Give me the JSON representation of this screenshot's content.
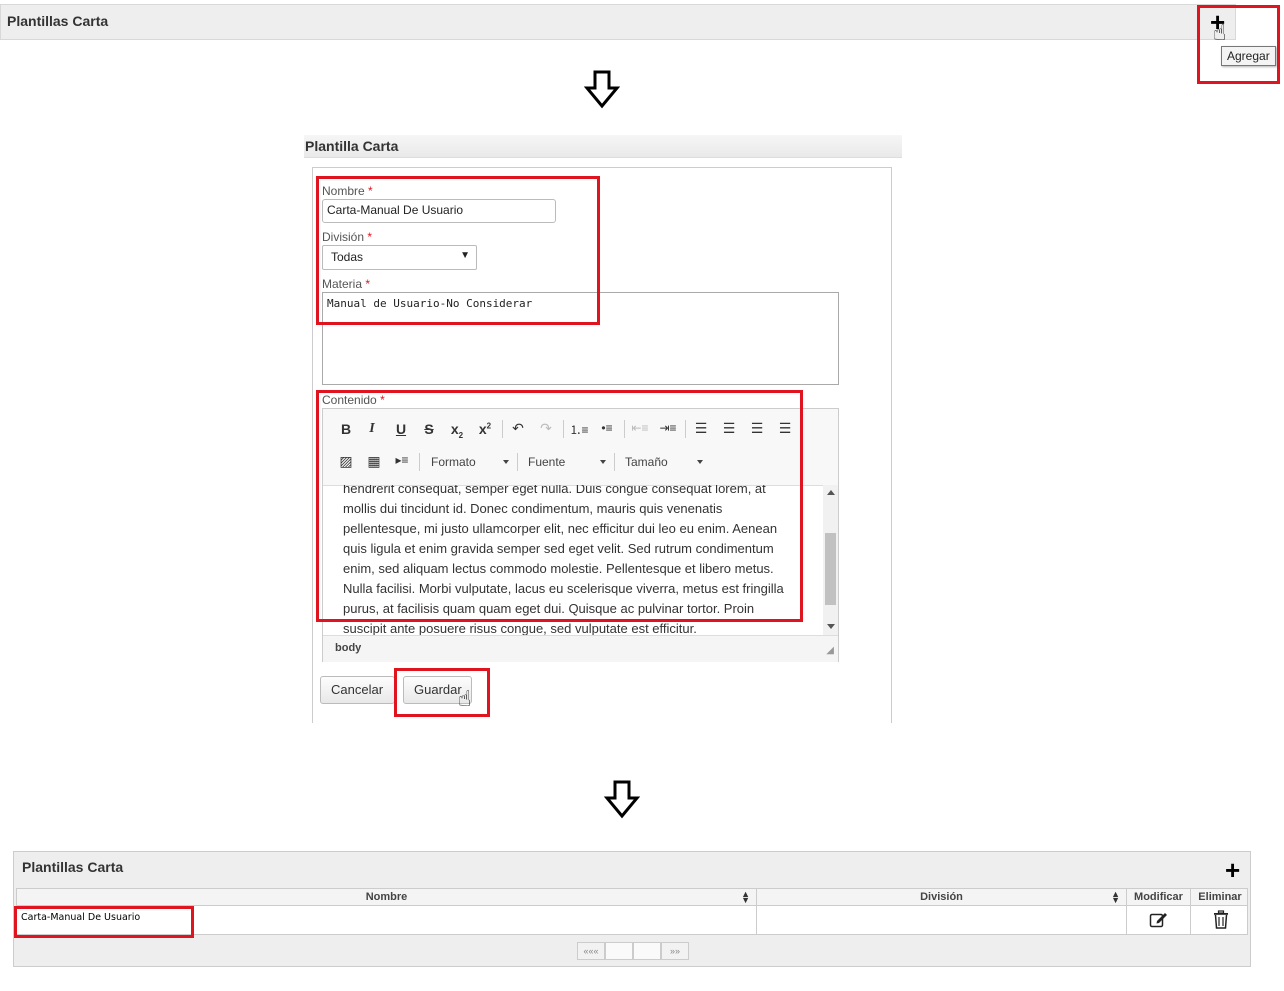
{
  "list_top": {
    "title": "Plantillas Carta",
    "tooltip": "Agregar",
    "add_icon": "plus-icon"
  },
  "form": {
    "title": "Plantilla Carta",
    "nombre_label": "Nombre",
    "nombre_value": "Carta-Manual De Usuario",
    "division_label": "División",
    "division_value": "Todas",
    "materia_label": "Materia",
    "materia_value": "Manual de Usuario-No Considerar",
    "contenido_label": "Contenido",
    "required_mark": "*",
    "editor": {
      "format_label": "Formato",
      "font_label": "Fuente",
      "size_label": "Tamaño",
      "status_path": "body",
      "lines": [
        "hendrerit consequat, semper eget nulla. Duis congue consequat lorem, at",
        "mollis dui tincidunt id. Donec condimentum, mauris quis venenatis",
        "pellentesque, mi justo ullamcorper elit, nec efficitur dui leo eu enim. Aenean",
        "quis ligula et enim gravida semper sed eget velit. Sed rutrum condimentum",
        "enim, sed aliquam lectus commodo molestie. Pellentesque et libero metus.",
        "Nulla facilisi. Morbi vulputate, lacus eu scelerisque viverra, metus est fringilla",
        "purus, at facilisis quam quam eget dui. Quisque ac pulvinar tortor. Proin",
        "suscipit ante posuere risus congue, sed vulputate est efficitur."
      ]
    },
    "cancel_label": "Cancelar",
    "save_label": "Guardar"
  },
  "grid": {
    "title": "Plantillas Carta",
    "columns": [
      "Nombre",
      "División",
      "Modificar",
      "Eliminar"
    ],
    "rows": [
      {
        "nombre": "Carta-Manual De Usuario",
        "division": ""
      }
    ],
    "pager_first": "«««",
    "pager_last": "»»"
  },
  "colors": {
    "highlight": "#e0141e",
    "header_bg": "#eeeeee"
  }
}
